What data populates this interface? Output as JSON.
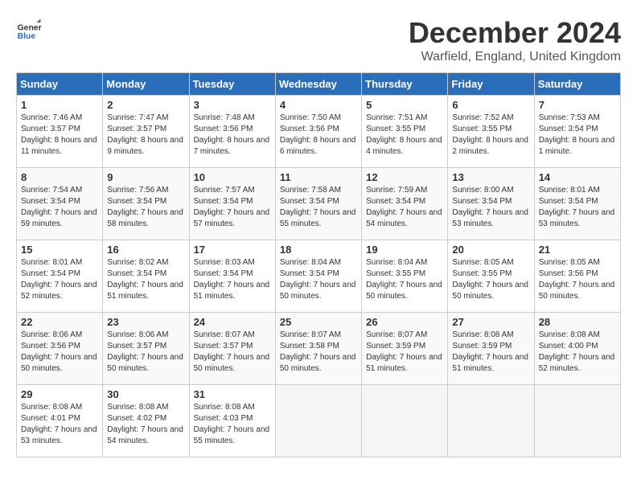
{
  "header": {
    "logo_line1": "General",
    "logo_line2": "Blue",
    "month_title": "December 2024",
    "location": "Warfield, England, United Kingdom"
  },
  "days_of_week": [
    "Sunday",
    "Monday",
    "Tuesday",
    "Wednesday",
    "Thursday",
    "Friday",
    "Saturday"
  ],
  "weeks": [
    [
      {
        "day": "1",
        "sunrise": "7:46 AM",
        "sunset": "3:57 PM",
        "daylight": "8 hours and 11 minutes."
      },
      {
        "day": "2",
        "sunrise": "7:47 AM",
        "sunset": "3:57 PM",
        "daylight": "8 hours and 9 minutes."
      },
      {
        "day": "3",
        "sunrise": "7:48 AM",
        "sunset": "3:56 PM",
        "daylight": "8 hours and 7 minutes."
      },
      {
        "day": "4",
        "sunrise": "7:50 AM",
        "sunset": "3:56 PM",
        "daylight": "8 hours and 6 minutes."
      },
      {
        "day": "5",
        "sunrise": "7:51 AM",
        "sunset": "3:55 PM",
        "daylight": "8 hours and 4 minutes."
      },
      {
        "day": "6",
        "sunrise": "7:52 AM",
        "sunset": "3:55 PM",
        "daylight": "8 hours and 2 minutes."
      },
      {
        "day": "7",
        "sunrise": "7:53 AM",
        "sunset": "3:54 PM",
        "daylight": "8 hours and 1 minute."
      }
    ],
    [
      {
        "day": "8",
        "sunrise": "7:54 AM",
        "sunset": "3:54 PM",
        "daylight": "7 hours and 59 minutes."
      },
      {
        "day": "9",
        "sunrise": "7:56 AM",
        "sunset": "3:54 PM",
        "daylight": "7 hours and 58 minutes."
      },
      {
        "day": "10",
        "sunrise": "7:57 AM",
        "sunset": "3:54 PM",
        "daylight": "7 hours and 57 minutes."
      },
      {
        "day": "11",
        "sunrise": "7:58 AM",
        "sunset": "3:54 PM",
        "daylight": "7 hours and 55 minutes."
      },
      {
        "day": "12",
        "sunrise": "7:59 AM",
        "sunset": "3:54 PM",
        "daylight": "7 hours and 54 minutes."
      },
      {
        "day": "13",
        "sunrise": "8:00 AM",
        "sunset": "3:54 PM",
        "daylight": "7 hours and 53 minutes."
      },
      {
        "day": "14",
        "sunrise": "8:01 AM",
        "sunset": "3:54 PM",
        "daylight": "7 hours and 53 minutes."
      }
    ],
    [
      {
        "day": "15",
        "sunrise": "8:01 AM",
        "sunset": "3:54 PM",
        "daylight": "7 hours and 52 minutes."
      },
      {
        "day": "16",
        "sunrise": "8:02 AM",
        "sunset": "3:54 PM",
        "daylight": "7 hours and 51 minutes."
      },
      {
        "day": "17",
        "sunrise": "8:03 AM",
        "sunset": "3:54 PM",
        "daylight": "7 hours and 51 minutes."
      },
      {
        "day": "18",
        "sunrise": "8:04 AM",
        "sunset": "3:54 PM",
        "daylight": "7 hours and 50 minutes."
      },
      {
        "day": "19",
        "sunrise": "8:04 AM",
        "sunset": "3:55 PM",
        "daylight": "7 hours and 50 minutes."
      },
      {
        "day": "20",
        "sunrise": "8:05 AM",
        "sunset": "3:55 PM",
        "daylight": "7 hours and 50 minutes."
      },
      {
        "day": "21",
        "sunrise": "8:05 AM",
        "sunset": "3:56 PM",
        "daylight": "7 hours and 50 minutes."
      }
    ],
    [
      {
        "day": "22",
        "sunrise": "8:06 AM",
        "sunset": "3:56 PM",
        "daylight": "7 hours and 50 minutes."
      },
      {
        "day": "23",
        "sunrise": "8:06 AM",
        "sunset": "3:57 PM",
        "daylight": "7 hours and 50 minutes."
      },
      {
        "day": "24",
        "sunrise": "8:07 AM",
        "sunset": "3:57 PM",
        "daylight": "7 hours and 50 minutes."
      },
      {
        "day": "25",
        "sunrise": "8:07 AM",
        "sunset": "3:58 PM",
        "daylight": "7 hours and 50 minutes."
      },
      {
        "day": "26",
        "sunrise": "8:07 AM",
        "sunset": "3:59 PM",
        "daylight": "7 hours and 51 minutes."
      },
      {
        "day": "27",
        "sunrise": "8:08 AM",
        "sunset": "3:59 PM",
        "daylight": "7 hours and 51 minutes."
      },
      {
        "day": "28",
        "sunrise": "8:08 AM",
        "sunset": "4:00 PM",
        "daylight": "7 hours and 52 minutes."
      }
    ],
    [
      {
        "day": "29",
        "sunrise": "8:08 AM",
        "sunset": "4:01 PM",
        "daylight": "7 hours and 53 minutes."
      },
      {
        "day": "30",
        "sunrise": "8:08 AM",
        "sunset": "4:02 PM",
        "daylight": "7 hours and 54 minutes."
      },
      {
        "day": "31",
        "sunrise": "8:08 AM",
        "sunset": "4:03 PM",
        "daylight": "7 hours and 55 minutes."
      },
      null,
      null,
      null,
      null
    ]
  ],
  "labels": {
    "sunrise": "Sunrise:",
    "sunset": "Sunset:",
    "daylight": "Daylight:"
  }
}
